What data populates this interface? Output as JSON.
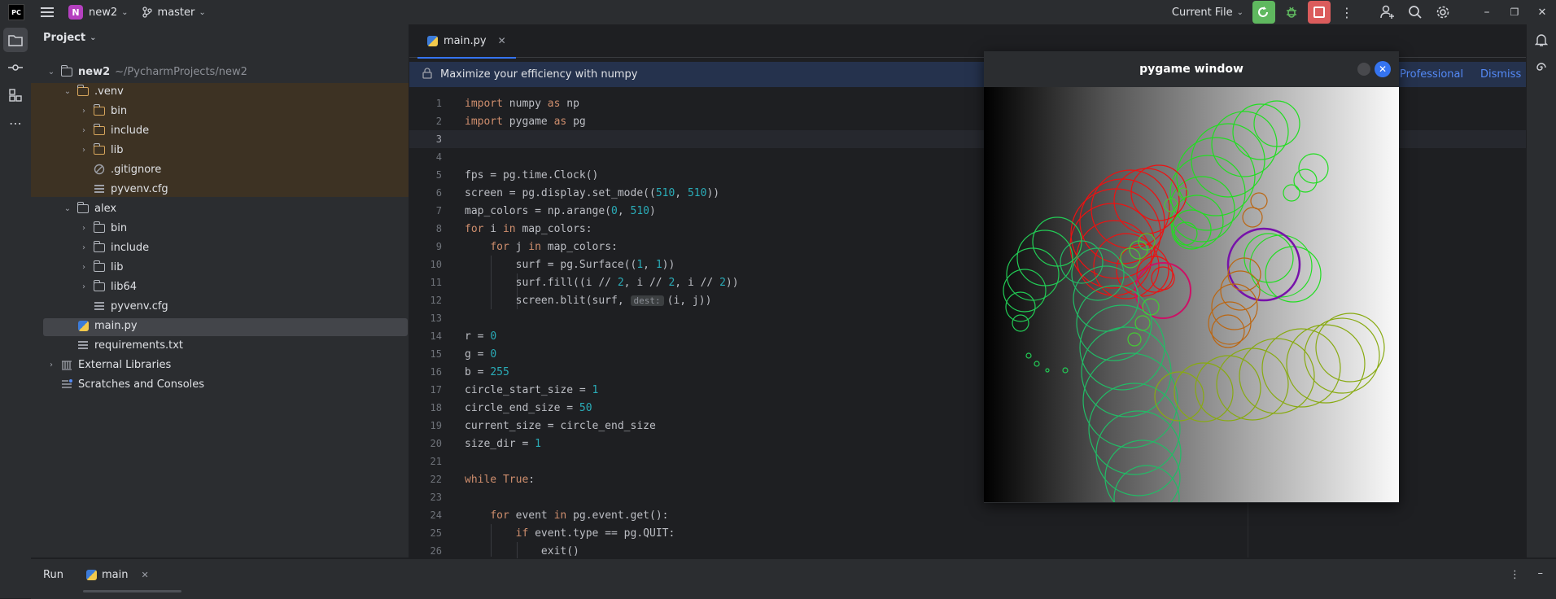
{
  "titlebar": {
    "logo": "PC",
    "project_badge": "N",
    "project_name": "new2",
    "branch": "master",
    "run_config": "Current File"
  },
  "project_panel": {
    "title": "Project",
    "items": [
      {
        "label": "new2",
        "path": "~/PycharmProjects/new2"
      },
      {
        "label": ".venv"
      },
      {
        "label": "bin"
      },
      {
        "label": "include"
      },
      {
        "label": "lib"
      },
      {
        "label": ".gitignore"
      },
      {
        "label": "pyvenv.cfg"
      },
      {
        "label": "alex"
      },
      {
        "label": "bin"
      },
      {
        "label": "include"
      },
      {
        "label": "lib"
      },
      {
        "label": "lib64"
      },
      {
        "label": "pyvenv.cfg"
      },
      {
        "label": "main.py"
      },
      {
        "label": "requirements.txt"
      },
      {
        "label": "External Libraries"
      },
      {
        "label": "Scratches and Consoles"
      }
    ]
  },
  "editor": {
    "tab_label": "main.py",
    "banner_text": "Maximize your efficiency with numpy",
    "banner_professional": "Professional",
    "banner_dismiss": "Dismiss",
    "current_line": 3
  },
  "pygame_window": {
    "title": "pygame window"
  },
  "runbar": {
    "run_label": "Run",
    "tab_label": "main"
  },
  "colors": {
    "accent": "#3574f0",
    "run_green": "#5fb85f",
    "stop_red": "#db5c5c",
    "venv_highlight": "#3d3223"
  }
}
